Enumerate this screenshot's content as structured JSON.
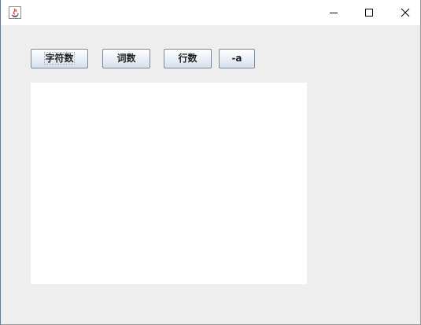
{
  "window": {
    "title": "",
    "app_icon": "java-icon",
    "controls": {
      "minimize_icon": "minimize-icon",
      "maximize_icon": "maximize-icon",
      "close_icon": "close-icon"
    }
  },
  "toolbar": {
    "char_count_label": "字符数",
    "word_count_label": "词数",
    "line_count_label": "行数",
    "all_label": "-a"
  },
  "text_area": {
    "value": ""
  },
  "colors": {
    "window_background": "#eeeeee",
    "titlebar_background": "#ffffff",
    "text_area_background": "#ffffff",
    "button_border": "#7a8a99"
  }
}
